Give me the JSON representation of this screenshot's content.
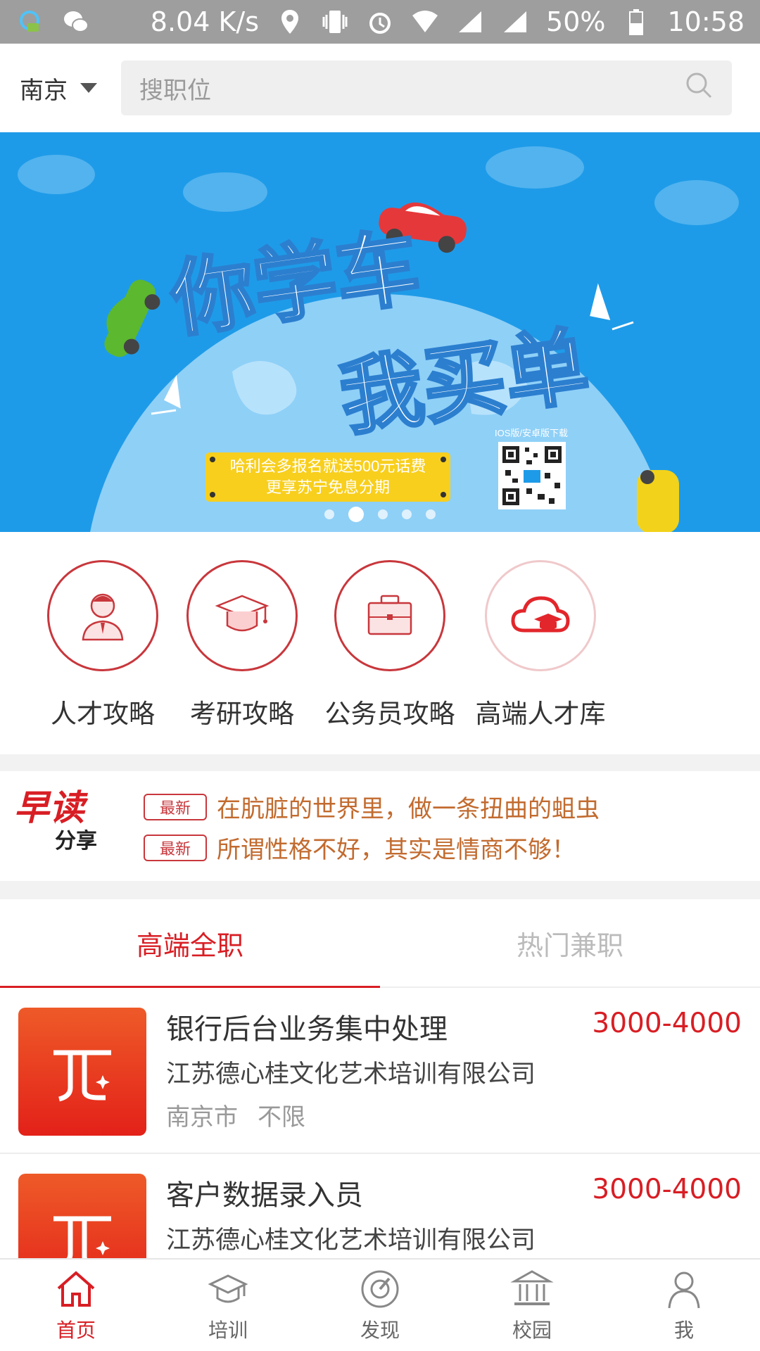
{
  "status": {
    "speed": "8.04 K/s",
    "battery": "50%",
    "time": "10:58"
  },
  "header": {
    "city": "南京",
    "search_placeholder": "搜职位"
  },
  "banner": {
    "line1": "你学车",
    "line2": "我买单",
    "promo1": "哈利会多报名就送500元话费",
    "promo2": "更享苏宁免息分期",
    "qr_caption": "IOS版/安卓版下载",
    "slides": 5,
    "active_slide": 2
  },
  "quick": [
    {
      "label": "人才攻略",
      "icon": "person-tie-icon"
    },
    {
      "label": "考研攻略",
      "icon": "graduation-cap-icon"
    },
    {
      "label": "公务员攻略",
      "icon": "briefcase-icon"
    },
    {
      "label": "高端人才库",
      "icon": "cloud-cap-icon"
    }
  ],
  "news": {
    "logo_top": "早读",
    "logo_bottom": "分享",
    "items": [
      {
        "badge": "最新",
        "text": "在肮脏的世界里，做一条扭曲的蛆虫"
      },
      {
        "badge": "最新",
        "text": "所谓性格不好，其实是情商不够！"
      }
    ]
  },
  "tabs": [
    "高端全职",
    "热门兼职"
  ],
  "jobs": [
    {
      "title": "银行后台业务集中处理",
      "salary": "3000-4000",
      "company": "江苏德心桂文化艺术培训有限公司",
      "city": "南京市",
      "req": "不限"
    },
    {
      "title": "客户数据录入员",
      "salary": "3000-4000",
      "company": "江苏德心桂文化艺术培训有限公司",
      "city": "",
      "req": ""
    }
  ],
  "tabbar": [
    "首页",
    "培训",
    "发现",
    "校园",
    "我"
  ],
  "colors": {
    "accent": "#d81e24",
    "banner": "#1e9be8",
    "news_text": "#c26b2f"
  }
}
